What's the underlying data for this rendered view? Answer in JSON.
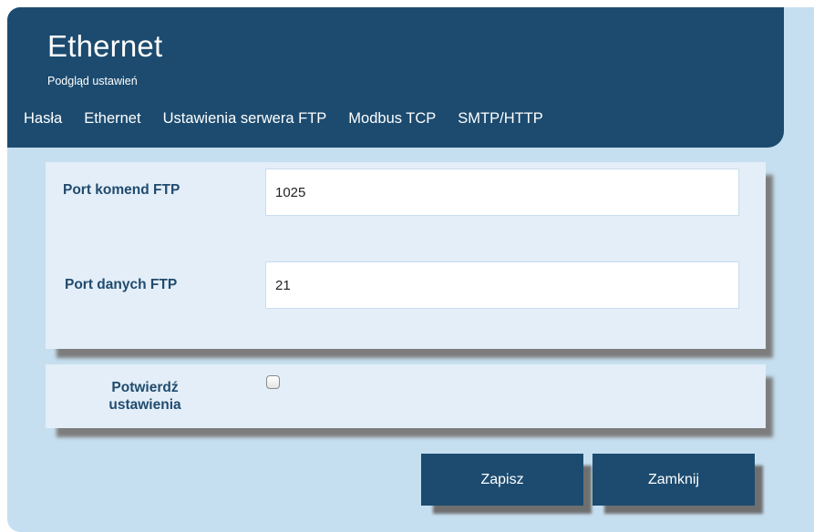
{
  "header": {
    "title": "Ethernet",
    "subtitle": "Podgląd ustawień"
  },
  "nav": {
    "items": [
      "Hasła",
      "Ethernet",
      "Ustawienia serwera FTP",
      "Modbus TCP",
      "SMTP/HTTP"
    ]
  },
  "form": {
    "ftp_command_port_label": "Port komend FTP",
    "ftp_command_port_value": "1025",
    "ftp_data_port_label": "Port danych FTP",
    "ftp_data_port_value": "21",
    "confirm_label_line1": "Potwierdź",
    "confirm_label_line2": "ustawienia",
    "confirm_checked": false
  },
  "buttons": {
    "save": "Zapisz",
    "close": "Zamknij"
  },
  "colors": {
    "header_bg": "#1c4b6f",
    "window_bg": "#c6dff0",
    "panel_bg": "#e3eef8",
    "label_text": "#214b6e"
  }
}
